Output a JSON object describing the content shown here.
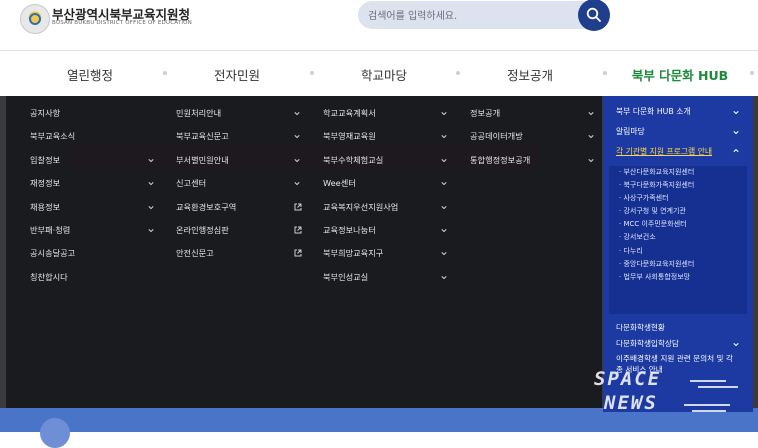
{
  "header": {
    "org_name": "부산광역시북부교육지원청",
    "org_name_en": "BUSAN BUKBU DISTRICT OFFICE OF EDUCATION",
    "search_placeholder": "검색어를 입력하세요."
  },
  "gnb": [
    {
      "label": "열린행정",
      "active": false
    },
    {
      "label": "전자민원",
      "active": false
    },
    {
      "label": "학교마당",
      "active": false
    },
    {
      "label": "정보공개",
      "active": false
    },
    {
      "label": "북부 다문화 HUB",
      "active": true
    }
  ],
  "mega_menu": {
    "columns": [
      [
        {
          "label": "공지사항",
          "mark": ""
        },
        {
          "label": "북부교육소식",
          "mark": ""
        },
        {
          "label": "입찰정보",
          "mark": "chevron"
        },
        {
          "label": "재정정보",
          "mark": "chevron"
        },
        {
          "label": "채용정보",
          "mark": "chevron"
        },
        {
          "label": "반부패·청렴",
          "mark": "chevron"
        },
        {
          "label": "공시송달공고",
          "mark": ""
        },
        {
          "label": "칭찬합시다",
          "mark": ""
        }
      ],
      [
        {
          "label": "민원처리안내",
          "mark": "chevron"
        },
        {
          "label": "북부교육신문고",
          "mark": "chevron"
        },
        {
          "label": "부서별민원안내",
          "mark": "chevron"
        },
        {
          "label": "신고센터",
          "mark": "chevron"
        },
        {
          "label": "교육환경보호구역",
          "mark": "external"
        },
        {
          "label": "온라인행정심판",
          "mark": "external"
        },
        {
          "label": "안전신문고",
          "mark": "external"
        }
      ],
      [
        {
          "label": "학교교육계획서",
          "mark": "chevron"
        },
        {
          "label": "북부영재교육원",
          "mark": "chevron"
        },
        {
          "label": "북부수학체험교실",
          "mark": "chevron"
        },
        {
          "label": "Wee센터",
          "mark": "chevron"
        },
        {
          "label": "교육복지우선지원사업",
          "mark": "chevron"
        },
        {
          "label": "교육정보나눔터",
          "mark": "chevron"
        },
        {
          "label": "북부희망교육지구",
          "mark": "chevron"
        },
        {
          "label": "북부인성교실",
          "mark": "chevron"
        }
      ],
      [
        {
          "label": "정보공개",
          "mark": "chevron"
        },
        {
          "label": "공공데이터개방",
          "mark": "chevron"
        },
        {
          "label": "통합행정정보공개",
          "mark": "chevron"
        }
      ]
    ]
  },
  "hub_menu": {
    "top": [
      {
        "label": "북부 다문화 HUB 소개",
        "selected": false
      },
      {
        "label": "알림마당",
        "selected": false
      },
      {
        "label": "각 기관별 지원 프로그램 안내",
        "selected": true
      }
    ],
    "sub": [
      "· 부산다문화교육지원센터",
      "· 북구다문화가족지원센터",
      "· 사상구가족센터",
      "· 강서구청 및 연계기관",
      "· MCC 이주민문화센터",
      "· 강서보건소",
      "· 다누리",
      "· 중앙다문화교육지원센터",
      "· 법무부 사회통합정보망"
    ],
    "bottom": [
      {
        "label": "다문화학생현황",
        "chevron": false
      },
      {
        "label": "다문화학생입학상담",
        "chevron": true
      },
      {
        "label": "이주배경학생 지원 관련 문의처 및 각종 서비스 안내",
        "chevron": false
      }
    ]
  },
  "watermark": {
    "line1": "SPACE",
    "line2": "NEWS"
  },
  "colors": {
    "hub_blue": "#1d3aa3",
    "active_green": "#1d8a3a",
    "search_button": "#1f3f8c"
  }
}
